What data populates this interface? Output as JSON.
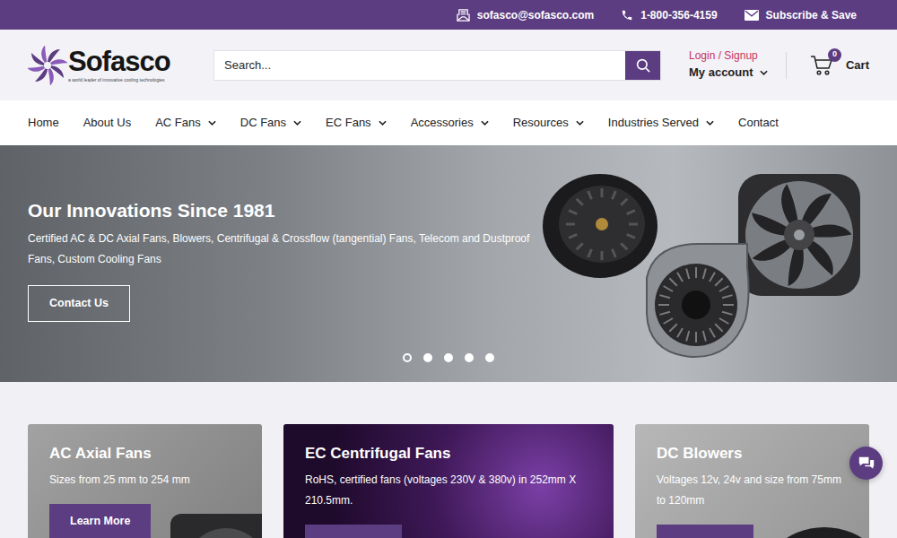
{
  "topbar": {
    "email": "sofasco@sofasco.com",
    "phone": "1-800-356-4159",
    "subscribe": "Subscribe & Save"
  },
  "logo": {
    "name": "Sofasco",
    "tagline": "a world leader of innovative cooling technologies"
  },
  "search": {
    "placeholder": "Search..."
  },
  "account": {
    "login": "Login / Signup",
    "label": "My account"
  },
  "cart": {
    "count": "0",
    "label": "Cart"
  },
  "nav": [
    {
      "label": "Home",
      "dropdown": false
    },
    {
      "label": "About Us",
      "dropdown": false
    },
    {
      "label": "AC Fans",
      "dropdown": true
    },
    {
      "label": "DC Fans",
      "dropdown": true
    },
    {
      "label": "EC Fans",
      "dropdown": true
    },
    {
      "label": "Accessories",
      "dropdown": true
    },
    {
      "label": "Resources",
      "dropdown": true
    },
    {
      "label": "Industries Served",
      "dropdown": true
    },
    {
      "label": "Contact",
      "dropdown": false
    }
  ],
  "hero": {
    "title": "Our Innovations Since 1981",
    "subtitle": "Certified AC & DC Axial Fans, Blowers, Centrifugal & Crossflow (tangential) Fans, Telecom and Dustproof Fans, Custom Cooling Fans",
    "button": "Contact Us",
    "slides": [
      {
        "selected": true
      },
      {
        "selected": false
      },
      {
        "selected": false
      },
      {
        "selected": false
      },
      {
        "selected": false
      }
    ]
  },
  "cards": [
    {
      "title": "AC Axial Fans",
      "text": "Sizes from 25 mm to 254 mm",
      "button": "Learn More",
      "kind": "axial"
    },
    {
      "title": "EC Centrifugal Fans",
      "text": "RoHS, certified fans (voltages 230V & 380v) in 252mm X 210.5mm.",
      "kind": "graphic"
    },
    {
      "title": "DC Blowers",
      "text": "Voltages 12v, 24v and size from 75mm to 120mm",
      "kind": "blower"
    }
  ]
}
